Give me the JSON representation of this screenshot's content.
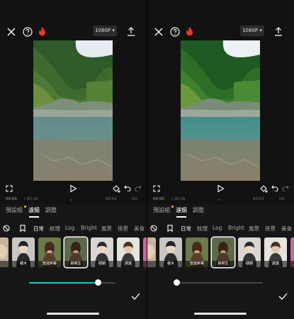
{
  "screens": [
    {
      "topbar": {
        "resolution": "1080P"
      },
      "timeline": {
        "current": "00:00",
        "total": "/ 00:16",
        "mark1": "00:02",
        "mark2": "00:"
      },
      "tabs": [
        "預設組",
        "濾鏡",
        "調整"
      ],
      "categories": [
        "日常",
        "紋理",
        "Log",
        "Bright",
        "風景",
        "夜景",
        "美食"
      ],
      "thumbs": [
        "",
        "積木",
        "聖誕幹聲",
        "柳寄生",
        "硬朗",
        "誘惑",
        ""
      ],
      "selected_filter": "柳寄生",
      "slider_value": 0.8
    },
    {
      "topbar": {
        "resolution": "1080P"
      },
      "timeline": {
        "current": "00:00",
        "total": "/ 00:16",
        "mark1": "00:02",
        "mark2": "00:"
      },
      "tabs": [
        "預設組",
        "濾鏡",
        "調整"
      ],
      "categories": [
        "日常",
        "紋理",
        "Log",
        "Bright",
        "風景",
        "夜景",
        "美食"
      ],
      "thumbs": [
        "",
        "積木",
        "聖誕幹聲",
        "柳寄生",
        "硬朗",
        "誘惑",
        ""
      ],
      "selected_filter": "柳寄生",
      "slider_value": 0.0
    }
  ],
  "colors": {
    "accent": "#2bc0c8",
    "badge": "#f5c21b",
    "flame": "#e8372b"
  },
  "icons": [
    "close-icon",
    "help-icon",
    "flame-icon",
    "upload-icon",
    "fullscreen-icon",
    "play-icon",
    "keyframe-icon",
    "undo-icon",
    "redo-icon",
    "no-filter-icon",
    "bookmark-icon",
    "check-icon"
  ]
}
